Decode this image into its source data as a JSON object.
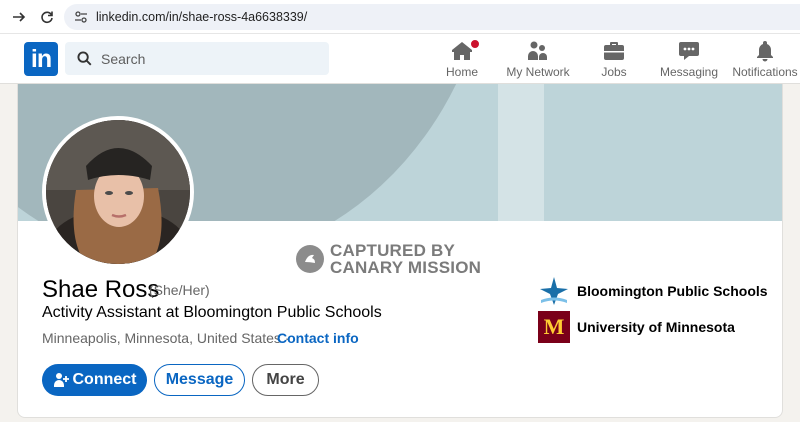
{
  "browser": {
    "url": "linkedin.com/in/shae-ross-4a6638339/",
    "back_icon": "arrow-right-icon",
    "reload_icon": "reload-icon"
  },
  "nav": {
    "logo": "in",
    "search_placeholder": "Search",
    "items": [
      {
        "label": "Home",
        "icon": "home-icon"
      },
      {
        "label": "My Network",
        "icon": "network-icon"
      },
      {
        "label": "Jobs",
        "icon": "briefcase-icon"
      },
      {
        "label": "Messaging",
        "icon": "messaging-icon"
      },
      {
        "label": "Notifications",
        "icon": "bell-icon"
      }
    ]
  },
  "watermark": {
    "line1": "CAPTURED BY",
    "line2": "CANARY MISSION"
  },
  "profile": {
    "name": "Shae Ross",
    "pronouns": "(She/Her)",
    "headline": "Activity Assistant at Bloomington Public Schools",
    "location": "Minneapolis, Minnesota, United States ·",
    "contact_label": "Contact info",
    "organizations": [
      {
        "name": "Bloomington Public Schools"
      },
      {
        "name": "University of Minnesota",
        "logo_text": "M"
      }
    ]
  },
  "actions": {
    "connect_label": "Connect",
    "message_label": "Message",
    "more_label": "More"
  },
  "colors": {
    "brand": "#0a66c2",
    "notification": "#cb112d",
    "umn_maroon": "#7a0019",
    "umn_gold": "#ffcc33"
  }
}
